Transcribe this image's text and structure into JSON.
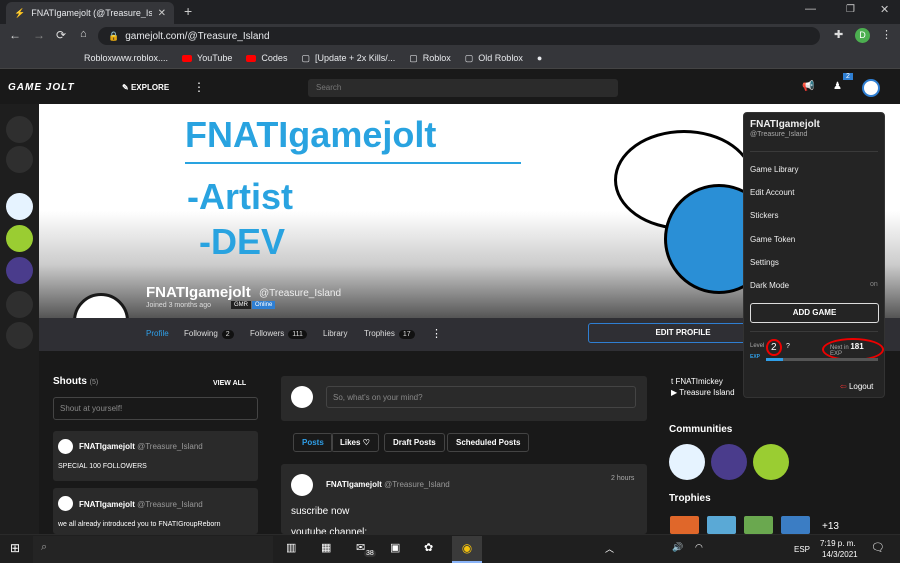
{
  "browser": {
    "tab_title": "FNATIgamejolt (@Treasure_Islan",
    "url": "gamejolt.com/@Treasure_Island",
    "bookmarks": [
      "Robloxwww.roblox....",
      "YouTube",
      "Codes",
      "[Update + 2x Kills/...",
      "Roblox",
      "Old Roblox"
    ],
    "profile_initial": "D"
  },
  "gamejolt": {
    "logo": "GAME JOLT",
    "explore": "EXPLORE",
    "search_placeholder": "Search",
    "notif_count": "2"
  },
  "banner": {
    "line1": "FNATIgamejolt",
    "line2": "-Artist",
    "line3": "-DEV"
  },
  "profile": {
    "name": "FNATIgamejolt",
    "handle": "@Treasure_Island",
    "joined": "Joined 3 months ago",
    "gmr": "GMR",
    "online": "Online",
    "tabs": [
      {
        "label": "Profile",
        "count": ""
      },
      {
        "label": "Following",
        "count": "2"
      },
      {
        "label": "Followers",
        "count": "111"
      },
      {
        "label": "Library",
        "count": ""
      },
      {
        "label": "Trophies",
        "count": "17"
      }
    ],
    "edit_button": "EDIT PROFILE"
  },
  "shouts": {
    "title": "Shouts",
    "count": "(5)",
    "view_all": "VIEW ALL",
    "placeholder": "Shout at yourself!",
    "items": [
      {
        "user": "FNATIgamejolt",
        "handle": "@Treasure_Island",
        "text": "SPECIAL 100 FOLLOWERS"
      },
      {
        "user": "FNATIgamejolt",
        "handle": "@Treasure_Island",
        "text": "we all already introduced you to FNATIGroupReborn"
      }
    ]
  },
  "feed": {
    "compose_placeholder": "So, what's on your mind?",
    "tabs": [
      "Posts",
      "Likes",
      "Draft Posts",
      "Scheduled Posts"
    ],
    "post": {
      "user": "FNATIgamejolt",
      "handle": "@Treasure_Island",
      "time": "2 hours",
      "text": "suscribe now",
      "text2": "youtube channel:"
    }
  },
  "sidebar": {
    "links": [
      "FNATImickey",
      "Treasure Island"
    ],
    "communities": "Communities",
    "trophies": "Trophies",
    "trophies_more": "+13"
  },
  "dropdown": {
    "name": "FNATIgamejolt",
    "handle": "@Treasure_Island",
    "items": [
      "Game Library",
      "Edit Account",
      "Stickers",
      "Game Token",
      "Settings",
      "Dark Mode"
    ],
    "dark_state": "on",
    "add_game": "ADD GAME",
    "level_label": "Level",
    "level": "2",
    "next_label": "Next in",
    "next_value": "181",
    "exp_unit": "EXP",
    "exp_tag": "EXP",
    "logout": "Logout"
  },
  "taskbar": {
    "badge": "38",
    "lang": "ESP",
    "time": "7:19 p. m.",
    "date": "14/3/2021"
  }
}
